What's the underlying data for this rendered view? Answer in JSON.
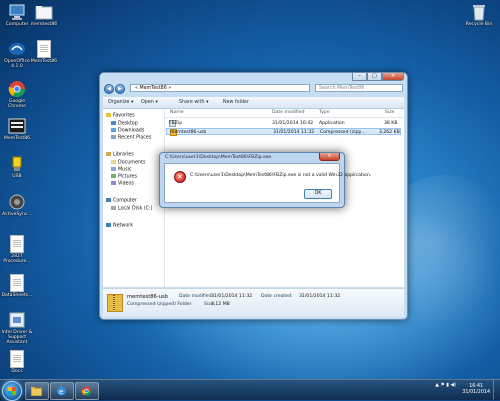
{
  "desktop": {
    "icons": [
      {
        "label": "Computer",
        "icon": "computer-icon"
      },
      {
        "label": "memtest86",
        "icon": "folder-icon"
      },
      {
        "label": "OpenOffice 4.1.0",
        "icon": "openoffice-icon"
      },
      {
        "label": "MemTest86",
        "icon": "memtest-icon"
      },
      {
        "label": "Google Chrome",
        "icon": "chrome-icon"
      },
      {
        "label": "MemTest86",
        "icon": "memtest-icon"
      },
      {
        "label": "USB",
        "icon": "usb-icon"
      },
      {
        "label": "ActiveSync...",
        "icon": "activesync-icon"
      },
      {
        "label": "2827 Procedure...",
        "icon": "document-icon"
      },
      {
        "label": "DataSheets...",
        "icon": "document-icon"
      },
      {
        "label": "Intel Driver & Support Assistant",
        "icon": "shortcut-icon"
      },
      {
        "label": "Docs",
        "icon": "document-icon"
      },
      {
        "label": "Recycle Bin",
        "icon": "recycle-bin-icon"
      }
    ]
  },
  "explorer": {
    "address": "« MemTest86 »",
    "search_placeholder": "Search MemTest86",
    "toolbar": {
      "organize": "Organize ▾",
      "open": "Open ▾",
      "share_with": "Share with ▾",
      "new_folder": "New folder"
    },
    "nav": {
      "favorites": "Favorites",
      "desktop": "Desktop",
      "downloads": "Downloads",
      "recent_places": "Recent Places",
      "libraries": "Libraries",
      "documents": "Documents",
      "music": "Music",
      "pictures": "Pictures",
      "videos": "Videos",
      "computer": "Computer",
      "local_disk": "Local Disk (C:)",
      "network": "Network"
    },
    "columns": {
      "name": "Name",
      "date": "Date modified",
      "type": "Type",
      "size": "Size"
    },
    "files": [
      {
        "name": "FBZip",
        "date": "31/01/2014 16:42",
        "type": "Application",
        "size": "38 KB"
      },
      {
        "name": "memtest86-usb",
        "date": "31/01/2014 11:32",
        "type": "Compressed (zipp...",
        "size": "3,262 KB"
      }
    ],
    "details": {
      "name": "memtest86-usb",
      "kind": "Compressed (zipped) Folder",
      "date_label": "Date modified:",
      "date_value": "31/01/2014 11:32",
      "size_label": "Size:",
      "size_value": "3,12 MB",
      "created_label": "Date created:",
      "created_value": "31/01/2014 11:32"
    }
  },
  "dialog": {
    "title": "C:\\Users\\user1\\Desktop\\MemTest86\\FBZip.exe",
    "message": "C:\\Users\\user1\\Desktop\\MemTest86\\FBZip.exe is not a valid Win32 application.",
    "ok": "OK"
  },
  "taskbar": {
    "time": "16:41",
    "date": "31/01/2014"
  }
}
